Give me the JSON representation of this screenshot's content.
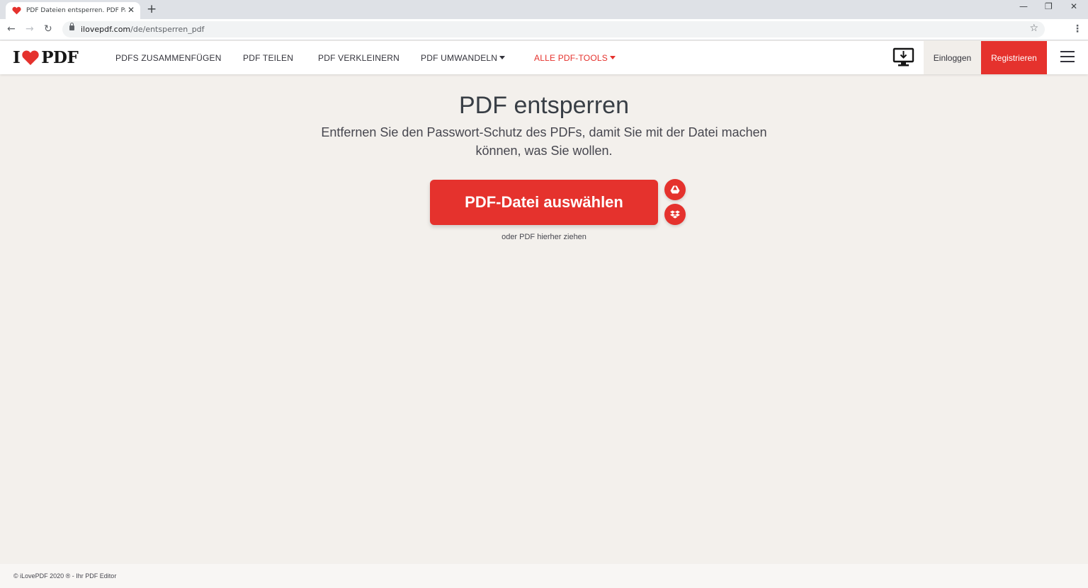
{
  "browser": {
    "tab_title": "PDF Dateien entsperren. PDF Pas",
    "tab_close": "✕",
    "new_tab": "+",
    "url_host": "ilovepdf.com",
    "url_path": "/de/entsperren_pdf",
    "window_controls": {
      "minimize": "—",
      "restore": "❐",
      "close": "✕"
    },
    "nav": {
      "back": "←",
      "forward": "→",
      "reload": "↻"
    },
    "star": "☆",
    "menu": "⋮"
  },
  "site": {
    "logo_left": "I",
    "logo_right": "PDF",
    "nav": [
      {
        "label": "PDFS ZUSAMMENFÜGEN"
      },
      {
        "label": "PDF TEILEN"
      },
      {
        "label": "PDF VERKLEINERN"
      },
      {
        "label": "PDF UMWANDELN"
      },
      {
        "label": "ALLE PDF-TOOLS"
      }
    ],
    "login": "Einloggen",
    "register": "Registrieren"
  },
  "main": {
    "title": "PDF entsperren",
    "subtitle": "Entfernen Sie den Passwort-Schutz des PDFs, damit Sie mit der Datei machen können, was Sie wollen.",
    "select_button": "PDF-Datei auswählen",
    "drop_hint": "oder PDF hierher ziehen"
  },
  "footer": {
    "text": "© iLovePDF 2020 ® - Ihr PDF Editor"
  },
  "colors": {
    "brand_red": "#e5322d",
    "background": "#f3f0ec",
    "text_dark": "#383e45"
  },
  "icons": {
    "tab_favicon": "heart-icon",
    "desktop": "desktop-download-icon",
    "google_drive": "google-drive-icon",
    "dropbox": "dropbox-icon",
    "menu": "hamburger-icon"
  }
}
